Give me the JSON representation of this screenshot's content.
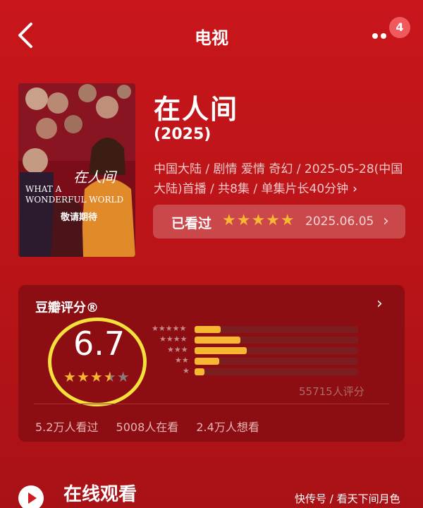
{
  "header": {
    "title": "电视",
    "badge_count": "4"
  },
  "poster": {
    "title_en_1": "WHAT A",
    "title_en_2": "WONDERFUL WORLD",
    "title_cn": "在人间",
    "tagline": "敬请期待"
  },
  "show": {
    "title": "在人间",
    "year": "(2025)",
    "meta": "中国大陆 / 剧情 爱情 奇幻 / 2025-05-28(中国大陆)首播 / 共8集 / 单集片长40分钟"
  },
  "watched": {
    "label": "已看过",
    "rating": 5,
    "max": 5,
    "date": "2025.06.05"
  },
  "rating": {
    "label": "豆瓣评分®",
    "score": "6.7",
    "stars": 3.5,
    "distribution": [
      {
        "stars": 5,
        "fraction": 0.16
      },
      {
        "stars": 4,
        "fraction": 0.28
      },
      {
        "stars": 3,
        "fraction": 0.32
      },
      {
        "stars": 2,
        "fraction": 0.15
      },
      {
        "stars": 1,
        "fraction": 0.06
      }
    ],
    "count_label": "55715人评分",
    "stats": [
      "5.2万人看过",
      "5008人在看",
      "2.4万人想看"
    ]
  },
  "online": {
    "label": "在线观看"
  },
  "watermark": "快传号 / 看天下间月色",
  "colors": {
    "background": "#c8161b",
    "accent_star": "#f7b733",
    "highlight_ring": "#f4e23a",
    "badge": "#f0595d"
  }
}
